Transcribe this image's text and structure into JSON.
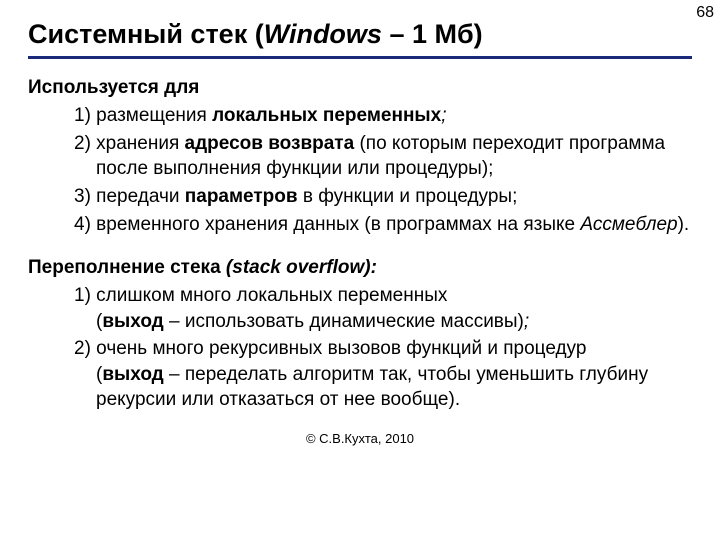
{
  "pageNumber": "68",
  "title": {
    "t1": "Системный стек (",
    "t2": "Windows",
    "t3": " – 1 Мб",
    "t4": ")"
  },
  "sectionA": {
    "lead": "Используется для",
    "i1a": "1) размещения ",
    "i1b": "локальных переменных",
    "i1c": ";",
    "i2a": "2) хранения ",
    "i2b": "адресов возврата",
    "i2c": " (по которым переходит программа после выполнения функции или процедуры);",
    "i3a": "3) передачи ",
    "i3b": "параметров",
    "i3c": " в функции и процедуры;",
    "i4a": "4) временного хранения данных (в программах на языке ",
    "i4b": "Ассмеблер",
    "i4c": ")."
  },
  "sectionB": {
    "leadA": "Переполнение стека ",
    "leadB": "(stack overflow):",
    "i1a": "1) слишком много локальных переменных",
    "i1b": "(",
    "i1c": "выход",
    "i1d": " – использовать динамические массивы)",
    "i1e": ";",
    "i2a": "2) очень много рекурсивных вызовов функций и процедур",
    "i2b": "(",
    "i2c": "выход",
    "i2d": " – переделать алгоритм так, чтобы уменьшить глубину рекурсии или отказаться от нее вообще)."
  },
  "footer": "© С.В.Кухта, 2010"
}
